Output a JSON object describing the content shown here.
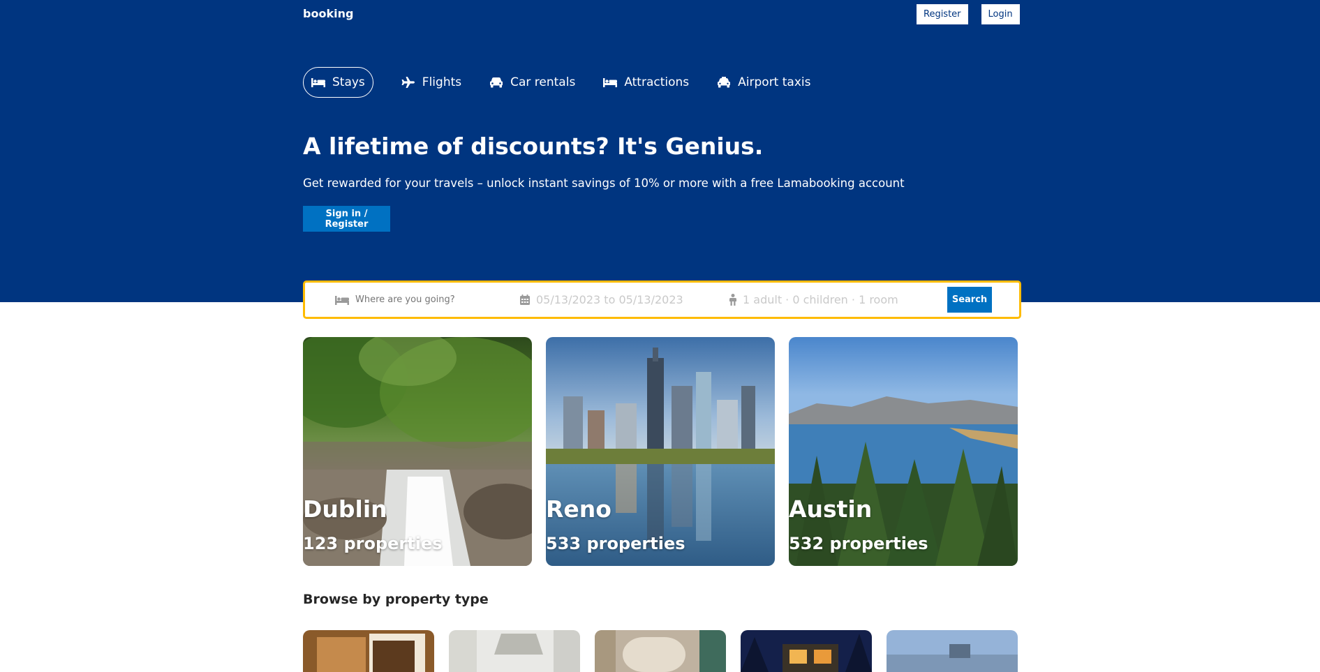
{
  "brand": {
    "logo": "booking"
  },
  "nav": {
    "register_label": "Register",
    "login_label": "Login"
  },
  "tabs": [
    {
      "label": "Stays",
      "icon": "bed-icon"
    },
    {
      "label": "Flights",
      "icon": "plane-icon"
    },
    {
      "label": "Car rentals",
      "icon": "car-icon"
    },
    {
      "label": "Attractions",
      "icon": "bed-icon"
    },
    {
      "label": "Airport taxis",
      "icon": "taxi-icon"
    }
  ],
  "hero": {
    "title": "A lifetime of discounts? It's Genius.",
    "subtitle": "Get rewarded for your travels – unlock instant savings of 10% or more with a free Lamabooking account",
    "cta_label": "Sign in / Register"
  },
  "search": {
    "destination_placeholder": "Where are you going?",
    "dates": "05/13/2023 to 05/13/2023",
    "occupancy": "1 adult · 0 children · 1 room",
    "button_label": "Search"
  },
  "featured": [
    {
      "city": "Dublin",
      "properties": "123 properties"
    },
    {
      "city": "Reno",
      "properties": "533 properties"
    },
    {
      "city": "Austin",
      "properties": "532 properties"
    }
  ],
  "property_types": {
    "title": "Browse by property type"
  },
  "colors": {
    "header_bg": "#003580",
    "accent": "#0071c2",
    "search_border": "#febb02"
  }
}
